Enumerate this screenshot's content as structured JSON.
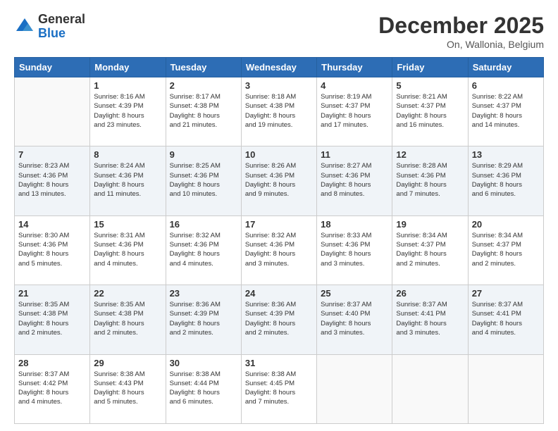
{
  "header": {
    "logo_general": "General",
    "logo_blue": "Blue",
    "month_title": "December 2025",
    "location": "On, Wallonia, Belgium"
  },
  "days_of_week": [
    "Sunday",
    "Monday",
    "Tuesday",
    "Wednesday",
    "Thursday",
    "Friday",
    "Saturday"
  ],
  "weeks": [
    [
      {
        "day": "",
        "info": ""
      },
      {
        "day": "1",
        "info": "Sunrise: 8:16 AM\nSunset: 4:39 PM\nDaylight: 8 hours\nand 23 minutes."
      },
      {
        "day": "2",
        "info": "Sunrise: 8:17 AM\nSunset: 4:38 PM\nDaylight: 8 hours\nand 21 minutes."
      },
      {
        "day": "3",
        "info": "Sunrise: 8:18 AM\nSunset: 4:38 PM\nDaylight: 8 hours\nand 19 minutes."
      },
      {
        "day": "4",
        "info": "Sunrise: 8:19 AM\nSunset: 4:37 PM\nDaylight: 8 hours\nand 17 minutes."
      },
      {
        "day": "5",
        "info": "Sunrise: 8:21 AM\nSunset: 4:37 PM\nDaylight: 8 hours\nand 16 minutes."
      },
      {
        "day": "6",
        "info": "Sunrise: 8:22 AM\nSunset: 4:37 PM\nDaylight: 8 hours\nand 14 minutes."
      }
    ],
    [
      {
        "day": "7",
        "info": "Sunrise: 8:23 AM\nSunset: 4:36 PM\nDaylight: 8 hours\nand 13 minutes."
      },
      {
        "day": "8",
        "info": "Sunrise: 8:24 AM\nSunset: 4:36 PM\nDaylight: 8 hours\nand 11 minutes."
      },
      {
        "day": "9",
        "info": "Sunrise: 8:25 AM\nSunset: 4:36 PM\nDaylight: 8 hours\nand 10 minutes."
      },
      {
        "day": "10",
        "info": "Sunrise: 8:26 AM\nSunset: 4:36 PM\nDaylight: 8 hours\nand 9 minutes."
      },
      {
        "day": "11",
        "info": "Sunrise: 8:27 AM\nSunset: 4:36 PM\nDaylight: 8 hours\nand 8 minutes."
      },
      {
        "day": "12",
        "info": "Sunrise: 8:28 AM\nSunset: 4:36 PM\nDaylight: 8 hours\nand 7 minutes."
      },
      {
        "day": "13",
        "info": "Sunrise: 8:29 AM\nSunset: 4:36 PM\nDaylight: 8 hours\nand 6 minutes."
      }
    ],
    [
      {
        "day": "14",
        "info": "Sunrise: 8:30 AM\nSunset: 4:36 PM\nDaylight: 8 hours\nand 5 minutes."
      },
      {
        "day": "15",
        "info": "Sunrise: 8:31 AM\nSunset: 4:36 PM\nDaylight: 8 hours\nand 4 minutes."
      },
      {
        "day": "16",
        "info": "Sunrise: 8:32 AM\nSunset: 4:36 PM\nDaylight: 8 hours\nand 4 minutes."
      },
      {
        "day": "17",
        "info": "Sunrise: 8:32 AM\nSunset: 4:36 PM\nDaylight: 8 hours\nand 3 minutes."
      },
      {
        "day": "18",
        "info": "Sunrise: 8:33 AM\nSunset: 4:36 PM\nDaylight: 8 hours\nand 3 minutes."
      },
      {
        "day": "19",
        "info": "Sunrise: 8:34 AM\nSunset: 4:37 PM\nDaylight: 8 hours\nand 2 minutes."
      },
      {
        "day": "20",
        "info": "Sunrise: 8:34 AM\nSunset: 4:37 PM\nDaylight: 8 hours\nand 2 minutes."
      }
    ],
    [
      {
        "day": "21",
        "info": "Sunrise: 8:35 AM\nSunset: 4:38 PM\nDaylight: 8 hours\nand 2 minutes."
      },
      {
        "day": "22",
        "info": "Sunrise: 8:35 AM\nSunset: 4:38 PM\nDaylight: 8 hours\nand 2 minutes."
      },
      {
        "day": "23",
        "info": "Sunrise: 8:36 AM\nSunset: 4:39 PM\nDaylight: 8 hours\nand 2 minutes."
      },
      {
        "day": "24",
        "info": "Sunrise: 8:36 AM\nSunset: 4:39 PM\nDaylight: 8 hours\nand 2 minutes."
      },
      {
        "day": "25",
        "info": "Sunrise: 8:37 AM\nSunset: 4:40 PM\nDaylight: 8 hours\nand 3 minutes."
      },
      {
        "day": "26",
        "info": "Sunrise: 8:37 AM\nSunset: 4:41 PM\nDaylight: 8 hours\nand 3 minutes."
      },
      {
        "day": "27",
        "info": "Sunrise: 8:37 AM\nSunset: 4:41 PM\nDaylight: 8 hours\nand 4 minutes."
      }
    ],
    [
      {
        "day": "28",
        "info": "Sunrise: 8:37 AM\nSunset: 4:42 PM\nDaylight: 8 hours\nand 4 minutes."
      },
      {
        "day": "29",
        "info": "Sunrise: 8:38 AM\nSunset: 4:43 PM\nDaylight: 8 hours\nand 5 minutes."
      },
      {
        "day": "30",
        "info": "Sunrise: 8:38 AM\nSunset: 4:44 PM\nDaylight: 8 hours\nand 6 minutes."
      },
      {
        "day": "31",
        "info": "Sunrise: 8:38 AM\nSunset: 4:45 PM\nDaylight: 8 hours\nand 7 minutes."
      },
      {
        "day": "",
        "info": ""
      },
      {
        "day": "",
        "info": ""
      },
      {
        "day": "",
        "info": ""
      }
    ]
  ]
}
